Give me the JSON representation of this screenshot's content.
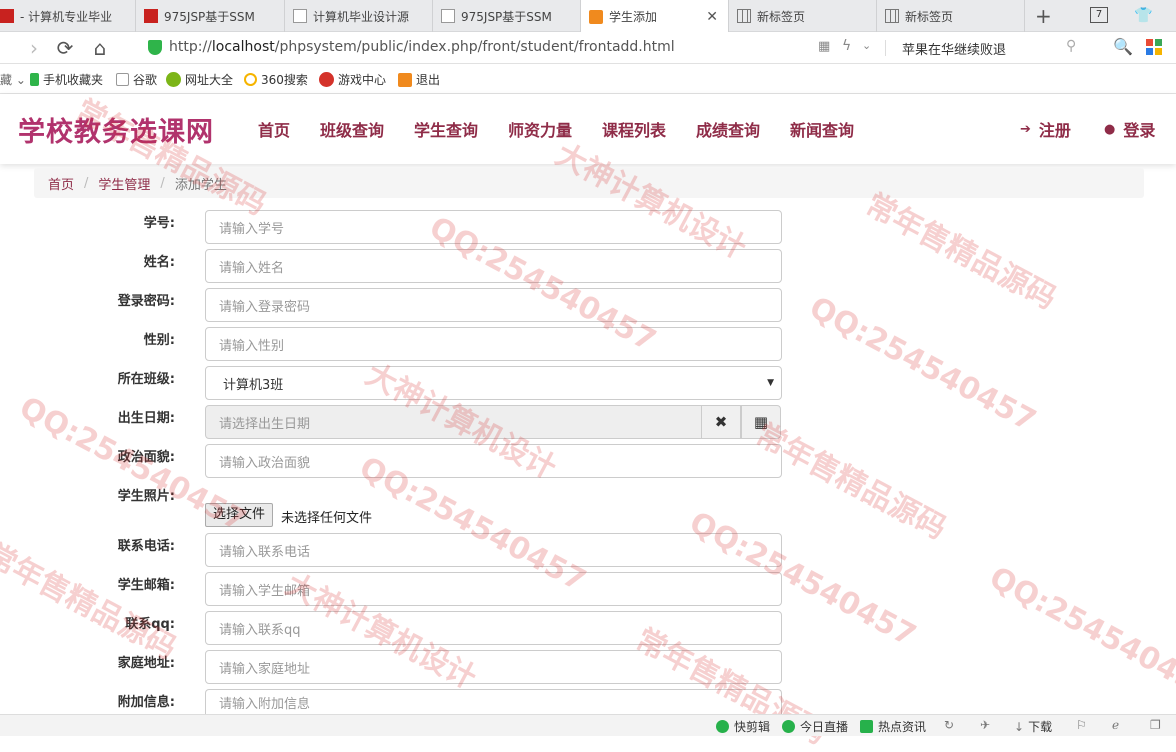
{
  "browser": {
    "tabs": [
      {
        "title": "- 计算机专业毕业",
        "icon": "red-favicon"
      },
      {
        "title": "975JSP基于SSM",
        "icon": "red-favicon"
      },
      {
        "title": "计算机毕业设计源",
        "icon": "page-icon"
      },
      {
        "title": "975JSP基于SSM",
        "icon": "page-icon"
      },
      {
        "title": "学生添加",
        "icon": "orange-favicon"
      },
      {
        "title": "新标签页",
        "icon": "grid-icon"
      },
      {
        "title": "新标签页",
        "icon": "grid-icon"
      }
    ],
    "tab_count": "7",
    "url_prefix": "http://",
    "url_host": "localhost",
    "url_path": "/phpsystem/public/index.php/front/student/frontadd.html",
    "search_suggestion": "苹果在华继续败退"
  },
  "bookmarks": [
    "手机收藏夹",
    "谷歌",
    "网址大全",
    "360搜索",
    "游戏中心",
    "退出"
  ],
  "site": {
    "logo": "学校教务选课网",
    "menu": [
      "首页",
      "班级查询",
      "学生查询",
      "师资力量",
      "课程列表",
      "成绩查询",
      "新闻查询"
    ],
    "register": "注册",
    "login": "登录"
  },
  "breadcrumb": {
    "home": "首页",
    "section": "学生管理",
    "current": "添加学生"
  },
  "form": {
    "student_id": {
      "label": "学号:",
      "placeholder": "请输入学号"
    },
    "name": {
      "label": "姓名:",
      "placeholder": "请输入姓名"
    },
    "password": {
      "label": "登录密码:",
      "placeholder": "请输入登录密码"
    },
    "gender": {
      "label": "性别:",
      "placeholder": "请输入性别"
    },
    "class": {
      "label": "所在班级:",
      "value": "计算机3班"
    },
    "birthday": {
      "label": "出生日期:",
      "placeholder": "请选择出生日期"
    },
    "politics": {
      "label": "政治面貌:",
      "placeholder": "请输入政治面貌"
    },
    "photo": {
      "label": "学生照片:",
      "button": "选择文件",
      "status": "未选择任何文件"
    },
    "phone": {
      "label": "联系电话:",
      "placeholder": "请输入联系电话"
    },
    "email": {
      "label": "学生邮箱:",
      "placeholder": "请输入学生邮箱"
    },
    "qq": {
      "label": "联系qq:",
      "placeholder": "请输入联系qq"
    },
    "address": {
      "label": "家庭地址:",
      "placeholder": "请输入家庭地址"
    },
    "memo": {
      "label": "附加信息:",
      "placeholder": "请输入附加信息"
    }
  },
  "statusbar": [
    "快剪辑",
    "今日直播",
    "热点资讯",
    "下载"
  ],
  "watermark": [
    "常年售精品源码",
    "QQ:254540457",
    "大神计算机设计"
  ],
  "colors": {
    "logo": "#b1336d",
    "menu": "#8f2c48",
    "watermark": "#d62828"
  }
}
